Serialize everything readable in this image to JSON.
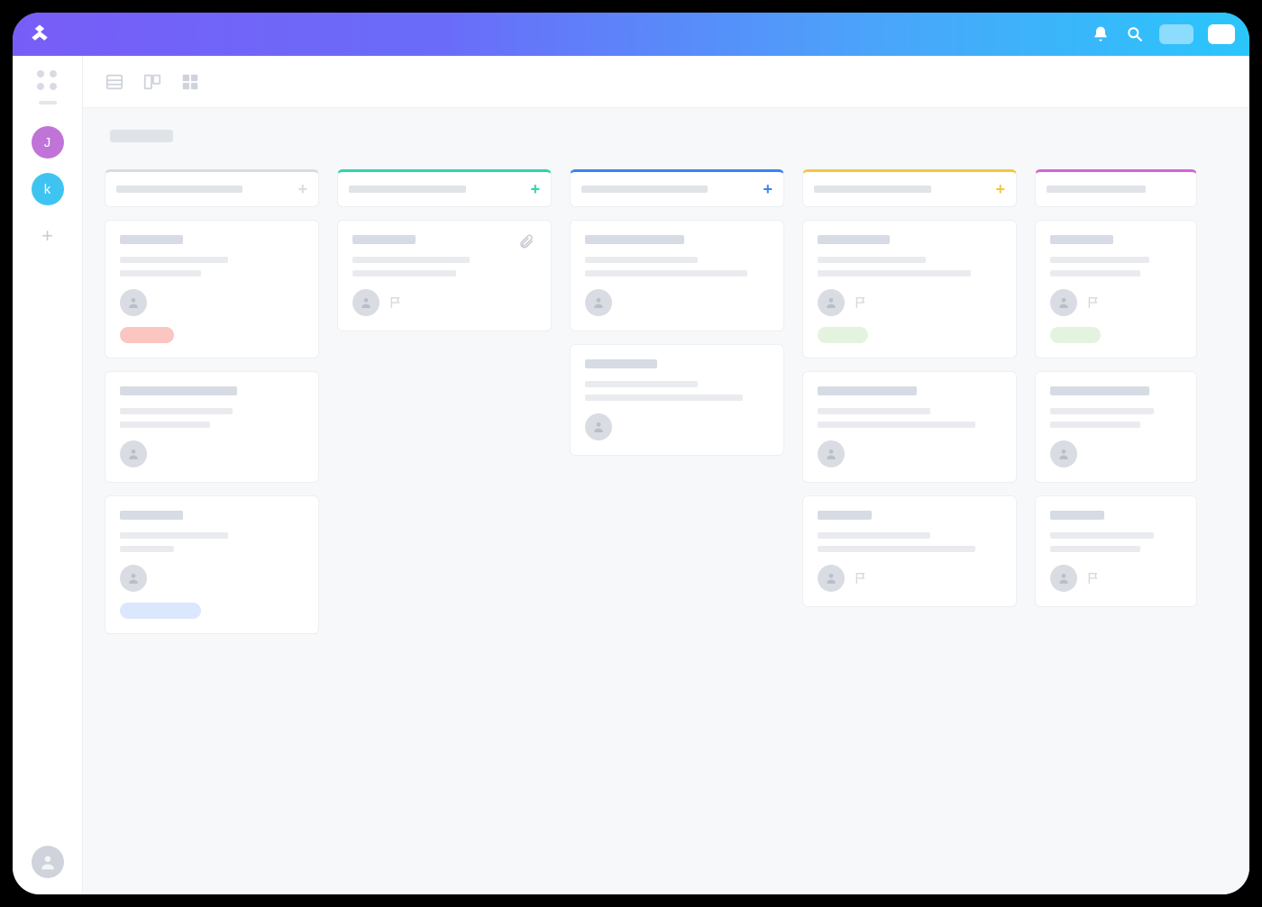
{
  "sidebar": {
    "members": [
      {
        "initial": "J",
        "color": "#c074d8"
      },
      {
        "initial": "k",
        "color": "#3fc4f2"
      }
    ]
  },
  "columns": [
    {
      "color": "#d7dbe3",
      "plusColor": "#d7dbe3",
      "labelWidth": 140,
      "cards": [
        {
          "titleWidth": 70,
          "lines": [
            120,
            90
          ],
          "hasFlag": false,
          "tagColor": "#fbc5c1",
          "tagWidth": 60
        },
        {
          "titleWidth": 130,
          "lines": [
            125,
            100
          ],
          "hasFlag": false
        },
        {
          "titleWidth": 70,
          "lines": [
            120,
            60
          ],
          "hasFlag": false,
          "tagColor": "#dbe7fc",
          "tagWidth": 90
        }
      ]
    },
    {
      "color": "#2dd4a9",
      "plusColor": "#2dd4a9",
      "labelWidth": 130,
      "cards": [
        {
          "titleWidth": 70,
          "lines": [
            130,
            115
          ],
          "hasFlag": true,
          "hasAttachment": true
        }
      ]
    },
    {
      "color": "#3b82f6",
      "plusColor": "#3b82f6",
      "labelWidth": 140,
      "cards": [
        {
          "titleWidth": 110,
          "lines": [
            125,
            180
          ],
          "hasFlag": false
        },
        {
          "titleWidth": 80,
          "lines": [
            125,
            175
          ],
          "hasFlag": false
        }
      ]
    },
    {
      "color": "#f5c542",
      "plusColor": "#f5c542",
      "labelWidth": 130,
      "cards": [
        {
          "titleWidth": 80,
          "lines": [
            120,
            170
          ],
          "hasFlag": true,
          "tagColor": "#e4f3df",
          "tagWidth": 56
        },
        {
          "titleWidth": 110,
          "lines": [
            125,
            175
          ],
          "hasFlag": false
        },
        {
          "titleWidth": 60,
          "lines": [
            125,
            175
          ],
          "hasFlag": true
        }
      ]
    },
    {
      "color": "#d264d6",
      "plusColor": "#d264d6",
      "labelWidth": 110,
      "partial": true,
      "cards": [
        {
          "titleWidth": 70,
          "lines": [
            110,
            100
          ],
          "hasFlag": true,
          "tagColor": "#e4f3df",
          "tagWidth": 56
        },
        {
          "titleWidth": 110,
          "lines": [
            115,
            100
          ],
          "hasFlag": false
        },
        {
          "titleWidth": 60,
          "lines": [
            115,
            100
          ],
          "hasFlag": true
        }
      ]
    }
  ]
}
